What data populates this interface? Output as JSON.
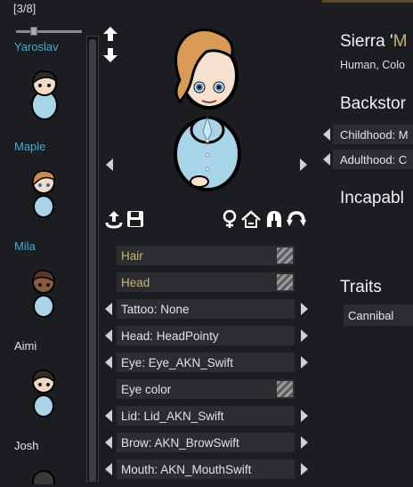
{
  "counter": "[3/8]",
  "pawns": [
    {
      "name": "Yaroslav",
      "color": "#3fb0d6",
      "hair": "#2a2a2a",
      "skin": "#f2dcc6"
    },
    {
      "name": "Maple",
      "color": "#3fb0d6",
      "hair": "#c98a4a",
      "skin": "#f3dac4"
    },
    {
      "name": "Mila",
      "color": "#3fb0d6",
      "hair": "#5a3a2a",
      "skin": "#8a5a3c"
    },
    {
      "name": "Aimi",
      "color": "#e6e6e6",
      "hair": "#3a2a22",
      "skin": "#f2d8c0"
    },
    {
      "name": "Josh",
      "color": "#e6e6e6",
      "hair": "#3a3a3a",
      "skin": "#f0d8c0"
    }
  ],
  "character": {
    "name_prefix": "Sierra '",
    "nickname": "M",
    "subtitle": "Human, Colo",
    "hair_color": "#d89a55",
    "skin_color": "#f6e0cf",
    "shirt_color": "#a8d4e8"
  },
  "sections": {
    "backstory": "Backstor",
    "childhood": "Childhood: M",
    "adulthood": "Adulthood: C",
    "incapable": "Incapabl",
    "traits": "Traits"
  },
  "traits": [
    "Cannibal"
  ],
  "rows": {
    "hair": "Hair",
    "head_color": "Head",
    "tattoo": "Tattoo: None",
    "head_type": "Head: HeadPointy",
    "eye": "Eye: Eye_AKN_Swift",
    "eye_color": "Eye color",
    "lid": "Lid: Lid_AKN_Swift",
    "brow": "Brow: AKN_BrowSwift",
    "mouth": "Mouth: AKN_MouthSwift"
  },
  "icons": [
    "export-icon",
    "save-icon",
    "female-icon",
    "home-icon",
    "helmet-icon",
    "rotate-icon"
  ],
  "accent": "#3fb0d6",
  "gold": "#c9b37a"
}
